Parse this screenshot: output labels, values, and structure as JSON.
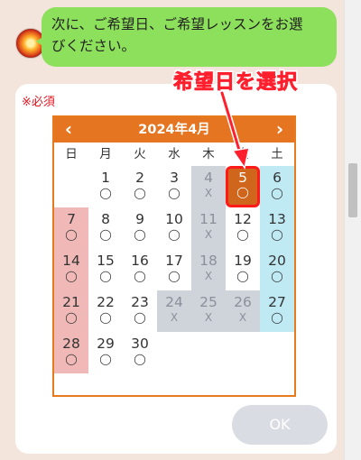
{
  "chat": {
    "bubble_line1": "次に、ご希望日、ご希望レッスンをお選",
    "bubble_line2": "びください。"
  },
  "annotation": {
    "text": "希望日を選択",
    "color": "#ff1f2d"
  },
  "form": {
    "required_label": "※必須"
  },
  "calendar": {
    "title": "2024年4月",
    "prev_label": "‹",
    "next_label": "›",
    "weekdays": [
      "日",
      "月",
      "火",
      "水",
      "木",
      "金",
      "土"
    ],
    "colors": {
      "header": "#e57520",
      "sunday": "#f0b9b7",
      "saturday": "#bfeaf4",
      "closed": "#cfd3da",
      "selected": "#d0661c"
    },
    "weeks": [
      [
        null,
        {
          "day": "1",
          "mark": "◯"
        },
        {
          "day": "2",
          "mark": "◯"
        },
        {
          "day": "3",
          "mark": "◯"
        },
        {
          "day": "4",
          "mark": "X",
          "closed": true
        },
        {
          "day": "5",
          "mark": "◯",
          "selected": true
        },
        {
          "day": "6",
          "mark": "◯"
        }
      ],
      [
        {
          "day": "7",
          "mark": "◯"
        },
        {
          "day": "8",
          "mark": "◯"
        },
        {
          "day": "9",
          "mark": "◯"
        },
        {
          "day": "10",
          "mark": "◯"
        },
        {
          "day": "11",
          "mark": "X",
          "closed": true
        },
        {
          "day": "12",
          "mark": "◯"
        },
        {
          "day": "13",
          "mark": "◯"
        }
      ],
      [
        {
          "day": "14",
          "mark": "◯"
        },
        {
          "day": "15",
          "mark": "◯"
        },
        {
          "day": "16",
          "mark": "◯"
        },
        {
          "day": "17",
          "mark": "◯"
        },
        {
          "day": "18",
          "mark": "X",
          "closed": true
        },
        {
          "day": "19",
          "mark": "◯"
        },
        {
          "day": "20",
          "mark": "◯"
        }
      ],
      [
        {
          "day": "21",
          "mark": "◯"
        },
        {
          "day": "22",
          "mark": "◯"
        },
        {
          "day": "23",
          "mark": "◯"
        },
        {
          "day": "24",
          "mark": "X",
          "closed": true
        },
        {
          "day": "25",
          "mark": "X",
          "closed": true
        },
        {
          "day": "26",
          "mark": "X",
          "closed": true
        },
        {
          "day": "27",
          "mark": "◯"
        }
      ],
      [
        {
          "day": "28",
          "mark": "◯"
        },
        {
          "day": "29",
          "mark": "◯"
        },
        {
          "day": "30",
          "mark": "◯"
        },
        null,
        null,
        null,
        null
      ]
    ]
  },
  "buttons": {
    "ok_label": "OK"
  }
}
